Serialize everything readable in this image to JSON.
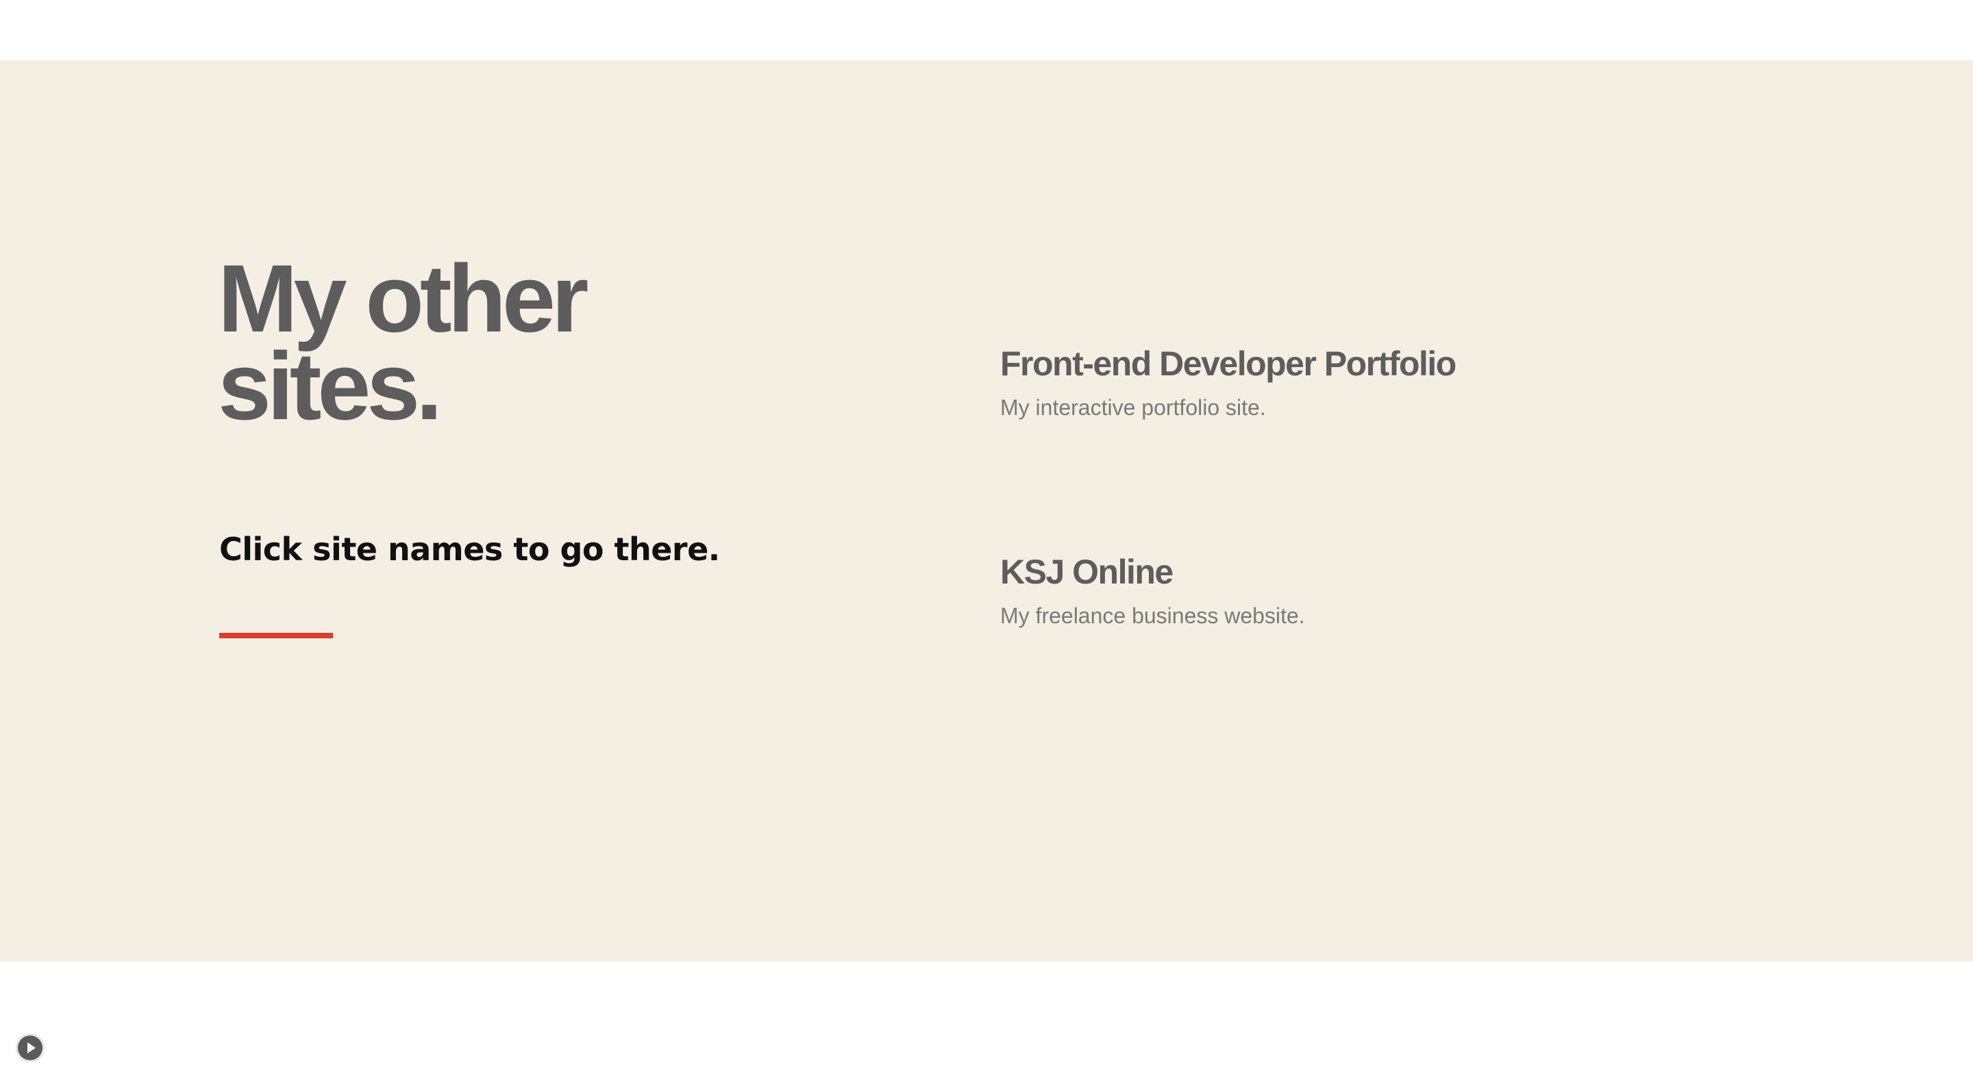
{
  "section": {
    "heading_line1": "My other",
    "heading_line2": "sites.",
    "subheading": "Click site names to go there."
  },
  "sites": [
    {
      "title": "Front-end Developer Portfolio",
      "description": "My interactive portfolio site."
    },
    {
      "title": "KSJ Online",
      "description": "My freelance business website."
    }
  ],
  "colors": {
    "background": "#f4eee3",
    "heading": "#5d5d5d",
    "accent": "#d84031",
    "description": "#7a7a7a"
  },
  "icons": {
    "play": "play-icon"
  }
}
